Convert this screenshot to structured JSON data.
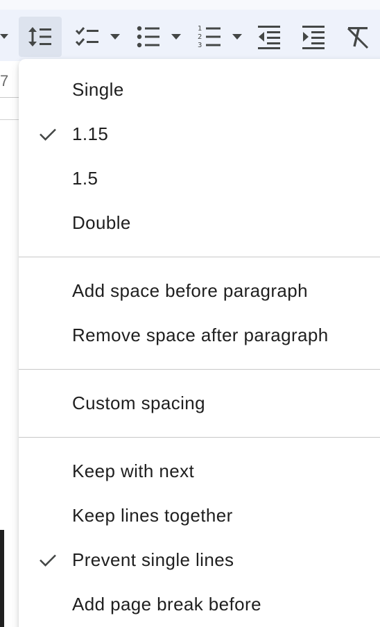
{
  "toolbar": {
    "buttons": [
      {
        "name": "line-spacing-icon",
        "active": true
      },
      {
        "name": "checklist-icon"
      },
      {
        "name": "bulleted-list-icon"
      },
      {
        "name": "numbered-list-icon"
      },
      {
        "name": "decrease-indent-icon"
      },
      {
        "name": "increase-indent-icon"
      },
      {
        "name": "clear-formatting-icon"
      }
    ]
  },
  "ruler": {
    "number": "7"
  },
  "menu": {
    "line_spacing": [
      {
        "label": "Single",
        "checked": false
      },
      {
        "label": "1.15",
        "checked": true
      },
      {
        "label": "1.5",
        "checked": false
      },
      {
        "label": "Double",
        "checked": false
      }
    ],
    "paragraph_space": [
      {
        "label": "Add space before paragraph"
      },
      {
        "label": "Remove space after paragraph"
      }
    ],
    "custom": [
      {
        "label": "Custom spacing"
      }
    ],
    "pagination": [
      {
        "label": "Keep with next",
        "checked": false
      },
      {
        "label": "Keep lines together",
        "checked": false
      },
      {
        "label": "Prevent single lines",
        "checked": true
      },
      {
        "label": "Add page break before",
        "checked": false
      }
    ]
  },
  "colors": {
    "toolbar_bg": "#eef2fb",
    "active_button_bg": "#dde3ee",
    "icon": "#444746",
    "text": "#1f1f1f",
    "separator": "#c7c7c7"
  }
}
